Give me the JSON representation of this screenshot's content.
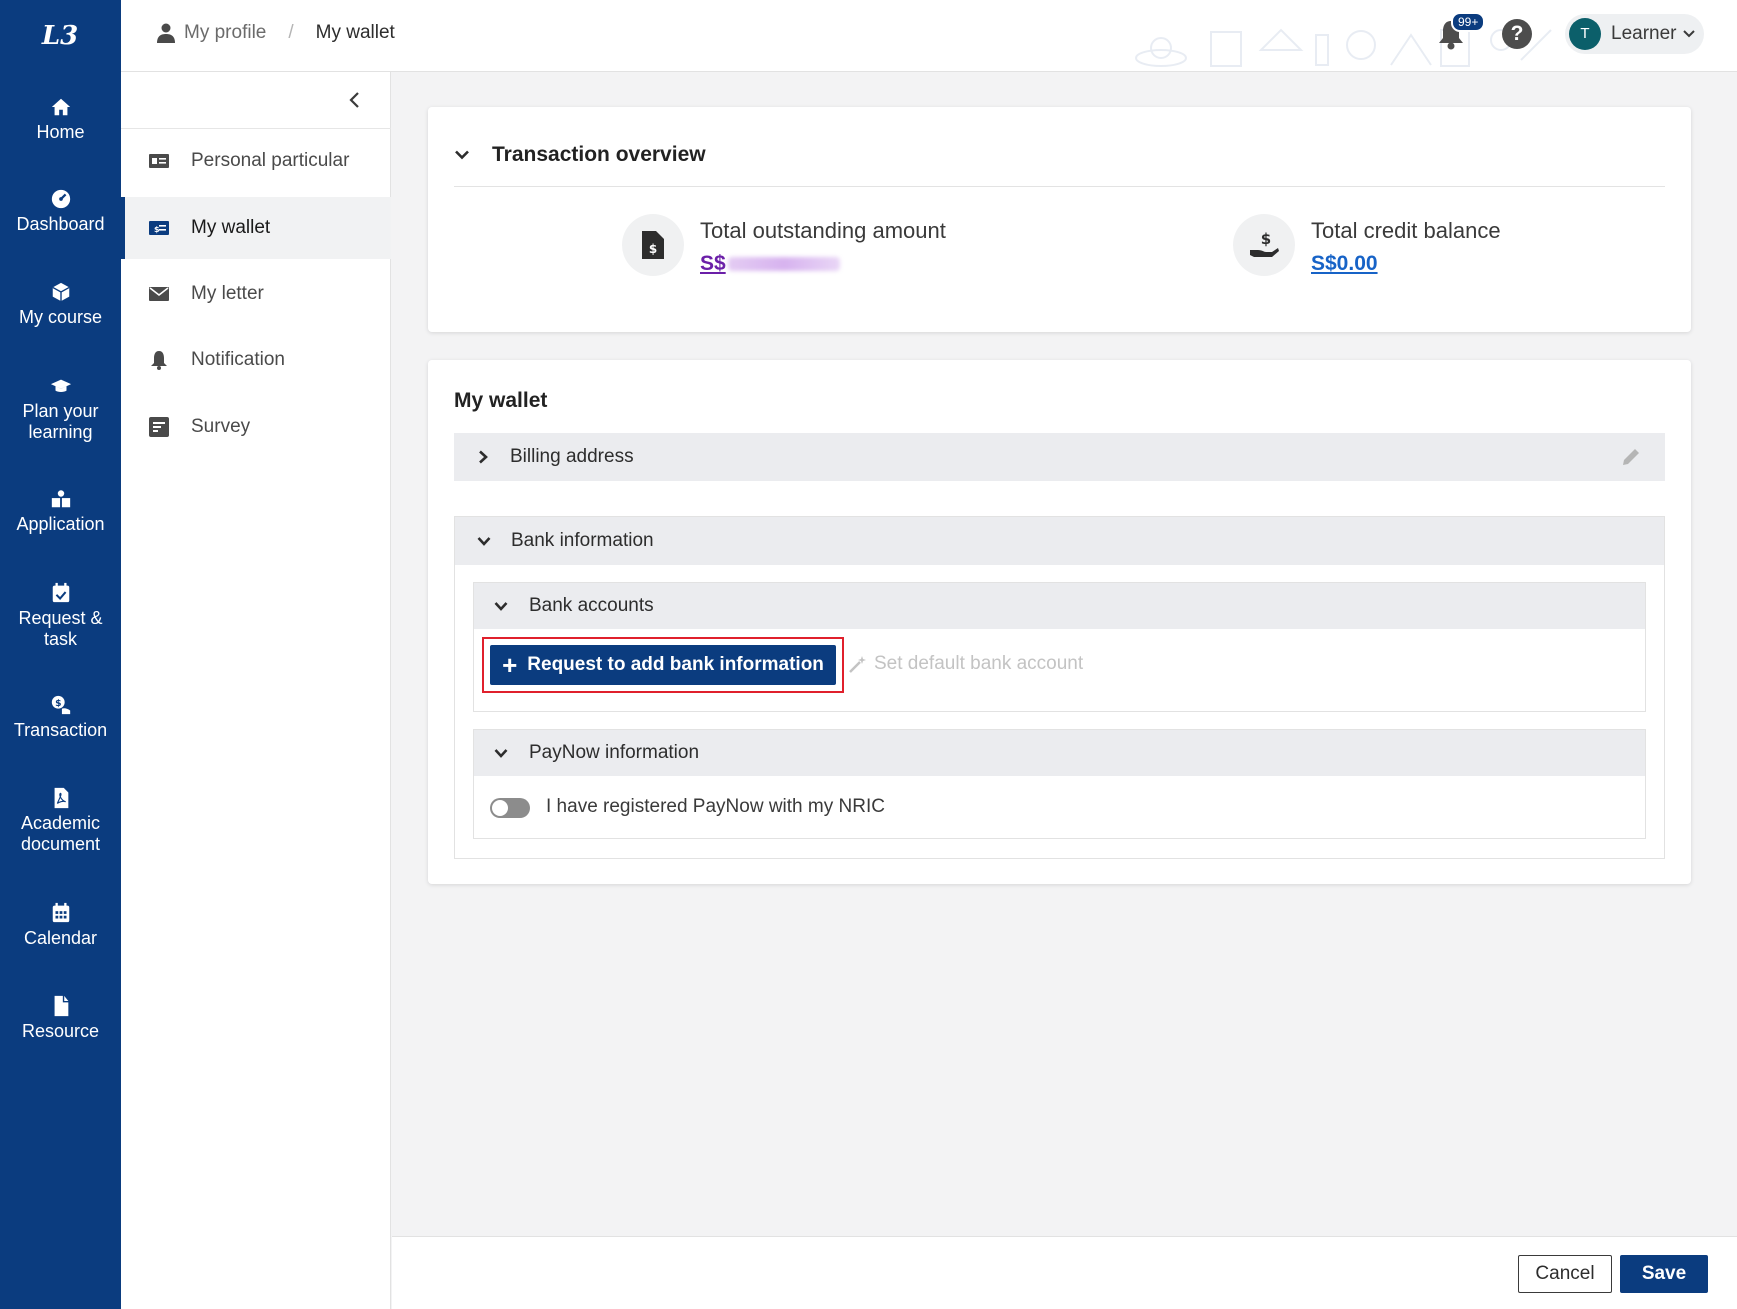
{
  "app": {
    "logo_text": "L3"
  },
  "nav": {
    "items": [
      {
        "label": "Home",
        "icon": "home-icon"
      },
      {
        "label": "Dashboard",
        "icon": "dashboard-icon"
      },
      {
        "label": "My course",
        "icon": "cube-icon"
      },
      {
        "label": "Plan your learning",
        "icon": "graduation-cap-icon"
      },
      {
        "label": "Application",
        "icon": "application-icon"
      },
      {
        "label": "Request & task",
        "icon": "calendar-check-icon"
      },
      {
        "label": "Transaction",
        "icon": "transaction-icon"
      },
      {
        "label": "Academic document",
        "icon": "pdf-file-icon"
      },
      {
        "label": "Calendar",
        "icon": "calendar-icon"
      },
      {
        "label": "Resource",
        "icon": "file-icon"
      }
    ]
  },
  "header": {
    "breadcrumb_parent": "My profile",
    "breadcrumb_separator": "/",
    "breadcrumb_current": "My wallet",
    "notification_badge": "99+",
    "help_label": "?",
    "user_initial": "T",
    "user_name": "Learner"
  },
  "submenu": {
    "items": [
      {
        "label": "Personal particular",
        "icon": "id-card-icon",
        "active": false
      },
      {
        "label": "My wallet",
        "icon": "wallet-card-icon",
        "active": true
      },
      {
        "label": "My letter",
        "icon": "envelope-icon",
        "active": false
      },
      {
        "label": "Notification",
        "icon": "bell-icon",
        "active": false
      },
      {
        "label": "Survey",
        "icon": "survey-icon",
        "active": false
      }
    ]
  },
  "overview": {
    "title": "Transaction overview",
    "outstanding_label": "Total outstanding amount",
    "outstanding_value": "S$",
    "credit_label": "Total credit balance",
    "credit_value": "S$0.00"
  },
  "wallet": {
    "title": "My wallet",
    "billing_label": "Billing address",
    "bank_info_label": "Bank information",
    "bank_accounts_label": "Bank accounts",
    "request_button": "Request to add bank information",
    "set_default_label": "Set default bank account",
    "paynow_label": "PayNow information",
    "paynow_toggle_label": "I have registered PayNow with my NRIC",
    "paynow_registered": false
  },
  "footer": {
    "cancel_label": "Cancel",
    "save_label": "Save"
  },
  "colors": {
    "primary": "#0b3c7f",
    "outstanding_link": "#6b1fa8",
    "credit_link": "#1763c7",
    "highlight_outline": "#e0202c"
  }
}
